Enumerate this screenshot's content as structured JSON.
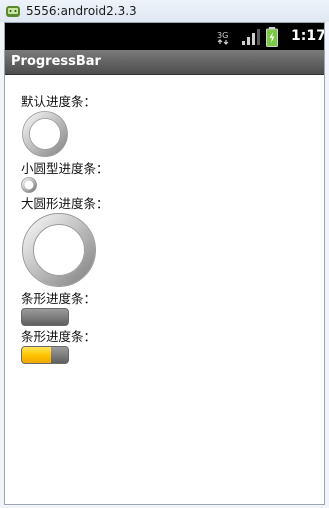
{
  "window": {
    "title": "5556:android2.3.3"
  },
  "statusbar": {
    "network_label": "3G",
    "time": "1:17"
  },
  "appbar": {
    "title": "ProgressBar"
  },
  "content": {
    "default_label": "默认进度条：",
    "small_label": "小圆型进度条：",
    "large_label": "大圆形进度条：",
    "bar_label": "条形进度条：",
    "bar2_label": "条形进度条：",
    "bar2_progress": 0.62
  },
  "colors": {
    "statusbar": "#000000",
    "appbar": "#5e5e5e",
    "progress_fill": "#ffc400",
    "battery": "#7ac943"
  }
}
